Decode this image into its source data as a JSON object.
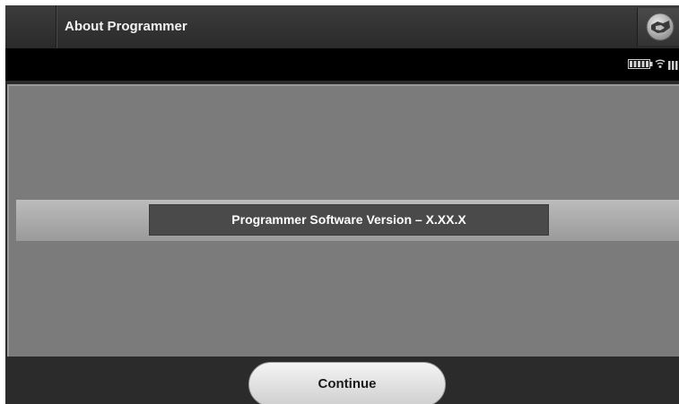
{
  "header": {
    "title": "About Programmer",
    "logo_icon": "handshake-icon"
  },
  "status_bar": {
    "icons": [
      "battery-icon",
      "wifi-icon",
      "signal-icon"
    ]
  },
  "main": {
    "version_text": "Programmer Software Version – X.XX.X"
  },
  "footer": {
    "continue_label": "Continue"
  },
  "colors": {
    "titlebar": "#2b2b2b",
    "statusbar": "#000000",
    "panel": "#7b7b7b",
    "version_box": "#4a4a4a",
    "button": "#e6e6e6"
  }
}
